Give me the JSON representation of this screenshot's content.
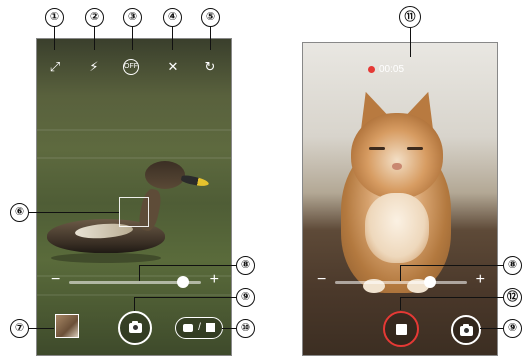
{
  "callouts": [
    "①",
    "②",
    "③",
    "④",
    "⑤",
    "⑥",
    "⑦",
    "⑧",
    "⑨",
    "⑩",
    "⑪",
    "⑧",
    "⑫",
    "⑨"
  ],
  "photo_screen": {
    "top_icons": {
      "mode": "⤢",
      "flash": "⚡",
      "timer": "OFF",
      "light": "✕",
      "switch": "↻"
    },
    "zoom": {
      "minus": "−",
      "plus": "+",
      "level": 0.86
    },
    "toggle": {
      "separator": "/"
    }
  },
  "video_screen": {
    "timer": "00:05",
    "zoom": {
      "minus": "−",
      "plus": "+",
      "level": 0.72
    }
  },
  "colors": {
    "record": "#e53935",
    "icon": "#ffffff"
  },
  "icons": [
    "switch-mode-icon",
    "flash-icon",
    "self-timer-icon",
    "light-icon",
    "switch-camera-icon",
    "shutter-icon",
    "stop-icon",
    "camera-icon",
    "video-icon"
  ]
}
